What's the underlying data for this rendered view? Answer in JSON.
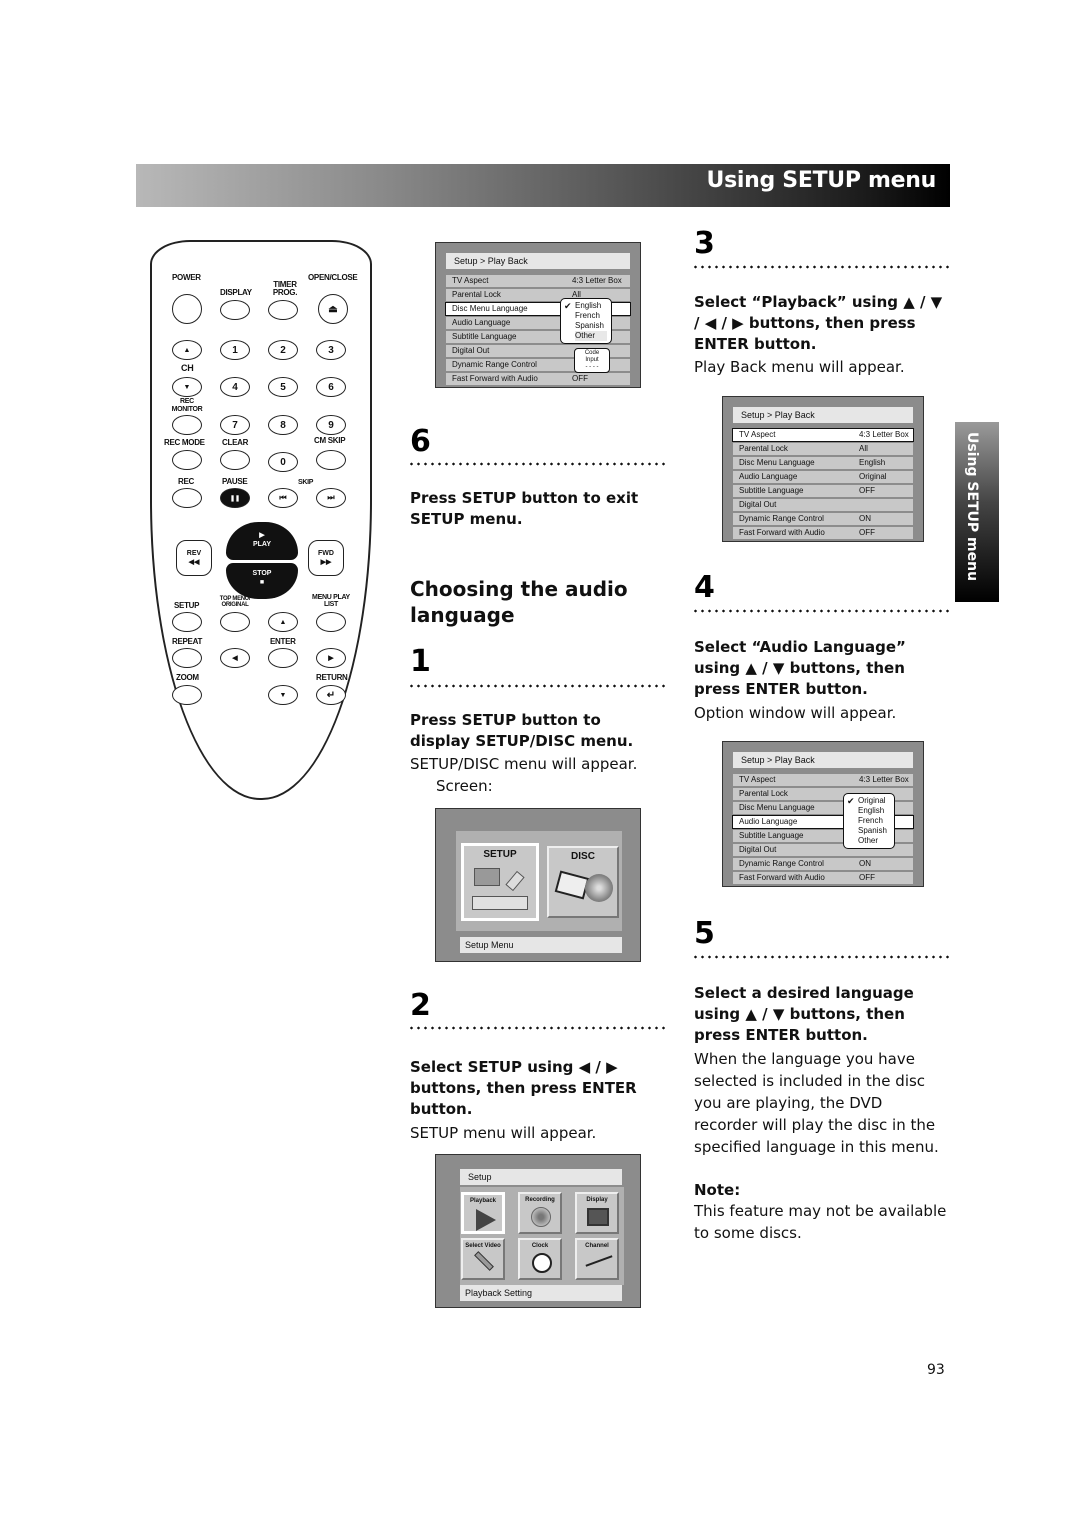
{
  "header": {
    "title": "Using SETUP menu"
  },
  "side_tab": {
    "label": "Using SETUP menu"
  },
  "remote": {
    "labels": {
      "power": "POWER",
      "display": "DISPLAY",
      "timer_prog": "TIMER PROG.",
      "open_close": "OPEN/CLOSE",
      "ch": "CH",
      "rec_monitor": "REC MONITOR",
      "rec_mode": "REC MODE",
      "clear": "CLEAR",
      "cm_skip": "CM SKIP",
      "rec": "REC",
      "pause": "PAUSE",
      "skip": "SKIP",
      "play": "PLAY",
      "stop": "STOP",
      "rev": "REV",
      "fwd": "FWD",
      "setup": "SETUP",
      "top_menu": "TOP MENU/ ORIGINAL",
      "menu_play_list": "MENU PLAY LIST",
      "repeat": "REPEAT",
      "enter": "ENTER",
      "zoom": "ZOOM",
      "return": "RETURN"
    },
    "digits": [
      "1",
      "2",
      "3",
      "4",
      "5",
      "6",
      "7",
      "8",
      "9",
      "0"
    ],
    "glyphs": {
      "eject": "⏏",
      "up": "▲",
      "down": "▼",
      "left": "◀",
      "right": "▶",
      "pause": "❚❚",
      "skip_back": "⏮",
      "skip_fwd": "⏭",
      "rev": "◀◀",
      "fwd": "▶▶",
      "play": "▶",
      "stop": "■",
      "return": "↵"
    }
  },
  "steps": {
    "step6": {
      "number": "6",
      "instruction": "Press SETUP button to exit SETUP menu."
    },
    "section_heading": "Choosing the audio language",
    "step1": {
      "number": "1",
      "instruction": "Press SETUP button to display SETUP/DISC menu.",
      "result": "SETUP/DISC menu will appear.",
      "screen_label": "Screen:"
    },
    "step2": {
      "number": "2",
      "instruction": "Select SETUP using ◀ / ▶ buttons, then press ENTER button.",
      "result": "SETUP menu will appear."
    },
    "step3": {
      "number": "3",
      "instruction": "Select “Playback” using ▲ / ▼ / ◀ / ▶ buttons, then press ENTER button.",
      "result": "Play Back menu will appear."
    },
    "step4": {
      "number": "4",
      "instruction": "Select “Audio Language” using ▲ / ▼ buttons, then press ENTER button.",
      "result": "Option window will appear."
    },
    "step5": {
      "number": "5",
      "instruction": "Select a desired language using ▲ / ▼ buttons, then press ENTER button.",
      "result": "When the language you have selected is included in the disc you are playing, the DVD recorder will play the disc in the specified language in this menu."
    },
    "note": {
      "title": "Note:",
      "text": "This feature may not be available to some discs."
    }
  },
  "screens": {
    "playback_menu": {
      "title": "Setup > Play Back",
      "rows": [
        {
          "label": "TV Aspect",
          "value": "4:3 Letter Box"
        },
        {
          "label": "Parental Lock",
          "value": "All"
        },
        {
          "label": "Disc Menu Language",
          "value": "English"
        },
        {
          "label": "Audio Language",
          "value": "Original"
        },
        {
          "label": "Subtitle Language",
          "value": "OFF"
        },
        {
          "label": "Digital Out",
          "value": ""
        },
        {
          "label": "Dynamic Range Control",
          "value": "ON"
        },
        {
          "label": "Fast Forward with Audio",
          "value": "OFF"
        }
      ]
    },
    "disc_lang_popup": {
      "options": [
        "English",
        "French",
        "Spanish",
        "Other"
      ],
      "selected": "English",
      "code_input_label": "Code Input",
      "code_input_value": "- - - -"
    },
    "audio_lang_popup": {
      "options": [
        "Original",
        "English",
        "French",
        "Spanish",
        "Other"
      ],
      "selected": "Original"
    },
    "setup_disc": {
      "tiles": [
        "SETUP",
        "DISC"
      ],
      "footer": "Setup Menu"
    },
    "setup_menu": {
      "title": "Setup",
      "tiles": [
        "Playback",
        "Recording",
        "Display",
        "Select Video",
        "Clock",
        "Channel"
      ],
      "footer": "Playback Setting"
    }
  },
  "page_number": "93"
}
